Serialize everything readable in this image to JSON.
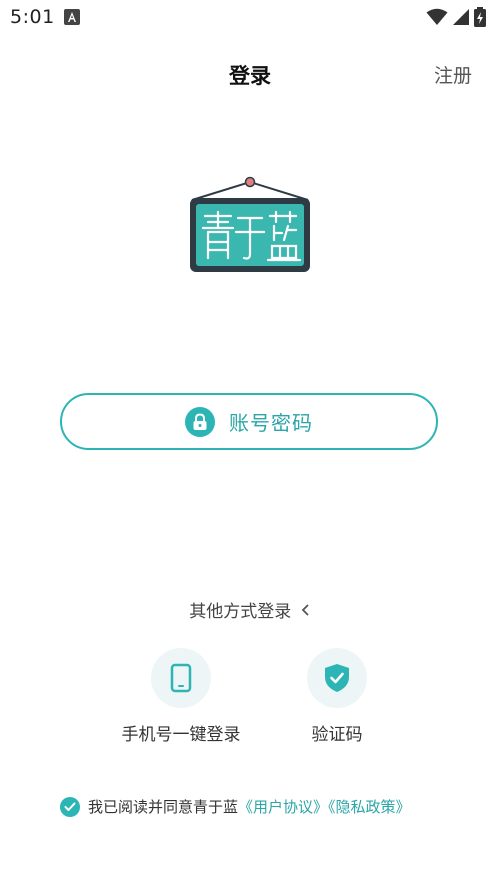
{
  "status_bar": {
    "time": "5:01"
  },
  "header": {
    "title": "登录",
    "register_label": "注册"
  },
  "logo": {
    "text": "青于蓝"
  },
  "login_buttons": {
    "account_password": "账号密码"
  },
  "other_methods": {
    "title": "其他方式登录",
    "toggle_icon": "chevron-left-icon",
    "items": [
      {
        "label": "手机号一键登录",
        "icon": "phone-icon"
      },
      {
        "label": "验证码",
        "icon": "shield-check-icon"
      }
    ]
  },
  "agreement": {
    "prefix": "我已阅读并同意青于蓝",
    "user_agreement": "《用户协议》",
    "privacy_policy": "《隐私政策》",
    "checked": true
  },
  "colors": {
    "accent": "#2db5b5",
    "logo_board": "#3ab8b0",
    "logo_pin": "#e07f7f"
  }
}
